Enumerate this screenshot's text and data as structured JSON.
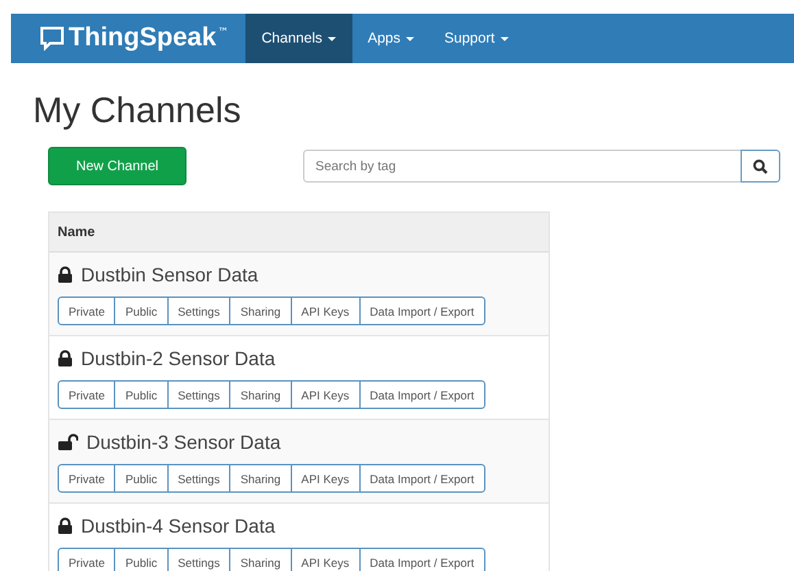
{
  "navbar": {
    "brand": "ThingSpeak",
    "trademark": "™",
    "items": [
      {
        "label": "Channels",
        "selected": true
      },
      {
        "label": "Apps",
        "selected": false
      },
      {
        "label": "Support",
        "selected": false
      }
    ]
  },
  "page_title": "My Channels",
  "new_button": "New Channel",
  "search": {
    "placeholder": "Search by tag"
  },
  "table": {
    "column": "Name",
    "rows": [
      {
        "name": "Dustbin Sensor Data",
        "locked": true,
        "actions": [
          "Private",
          "Public",
          "Settings",
          "Sharing",
          "API Keys",
          "Data Import / Export"
        ]
      },
      {
        "name": "Dustbin-2 Sensor Data",
        "locked": true,
        "actions": [
          "Private",
          "Public",
          "Settings",
          "Sharing",
          "API Keys",
          "Data Import / Export"
        ]
      },
      {
        "name": "Dustbin-3 Sensor Data",
        "locked": false,
        "actions": [
          "Private",
          "Public",
          "Settings",
          "Sharing",
          "API Keys",
          "Data Import / Export"
        ]
      },
      {
        "name": "Dustbin-4 Sensor Data",
        "locked": true,
        "actions": [
          "Private",
          "Public",
          "Settings",
          "Sharing",
          "API Keys",
          "Data Import / Export"
        ]
      }
    ]
  }
}
